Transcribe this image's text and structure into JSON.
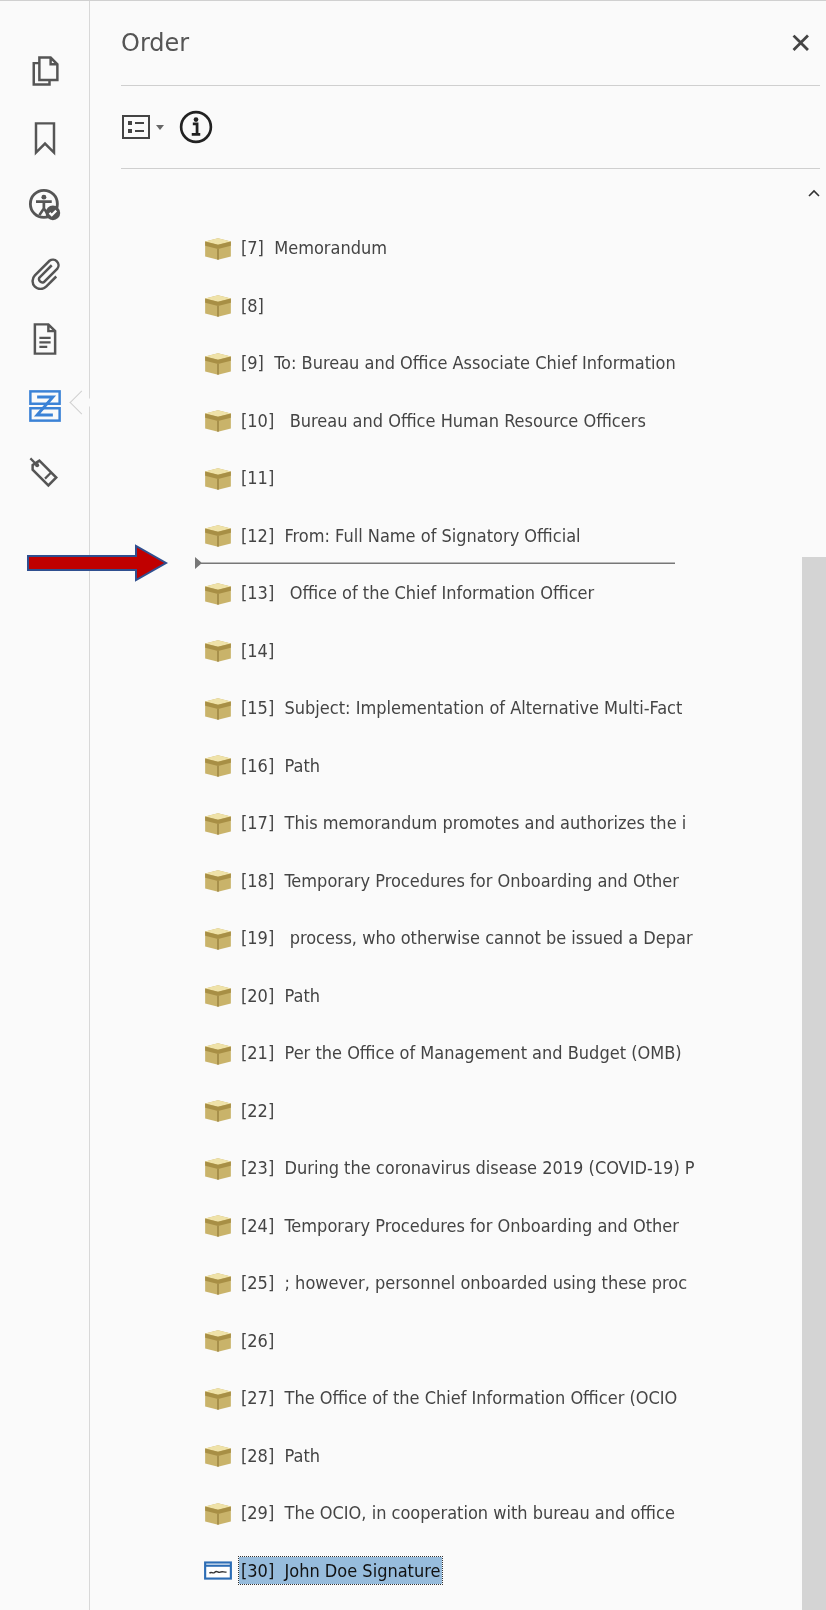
{
  "rail": [
    {
      "kind": "pages",
      "selected": false
    },
    {
      "kind": "bookmarks",
      "selected": false
    },
    {
      "kind": "accessibility",
      "selected": false
    },
    {
      "kind": "attachments",
      "selected": false
    },
    {
      "kind": "content",
      "selected": false
    },
    {
      "kind": "order",
      "selected": true
    },
    {
      "kind": "tags",
      "selected": false
    }
  ],
  "panel": {
    "title": "Order",
    "close": "✕"
  },
  "items": [
    {
      "kind": "container",
      "label": "[7]  Memorandum",
      "selected": false
    },
    {
      "kind": "container",
      "label": "[8]",
      "selected": false
    },
    {
      "kind": "container",
      "label": "[9]  To: Bureau and Office Associate Chief Information",
      "selected": false
    },
    {
      "kind": "container",
      "label": "[10]   Bureau and Office Human Resource Officers",
      "selected": false
    },
    {
      "kind": "container",
      "label": "[11]",
      "selected": false
    },
    {
      "kind": "container",
      "label": "[12]  From: Full Name of Signatory Official",
      "selected": false,
      "insert_after": true
    },
    {
      "kind": "container",
      "label": "[13]   Office of the Chief Information Officer",
      "selected": false
    },
    {
      "kind": "container",
      "label": "[14]",
      "selected": false
    },
    {
      "kind": "container",
      "label": "[15]  Subject: Implementation of Alternative Multi-Fact",
      "selected": false
    },
    {
      "kind": "container",
      "label": "[16]  Path",
      "selected": false
    },
    {
      "kind": "container",
      "label": "[17]  This memorandum promotes and authorizes the i",
      "selected": false
    },
    {
      "kind": "container",
      "label": "[18]  Temporary Procedures for Onboarding and Other",
      "selected": false
    },
    {
      "kind": "container",
      "label": "[19]   process, who otherwise cannot be issued a Depar",
      "selected": false
    },
    {
      "kind": "container",
      "label": "[20]  Path",
      "selected": false
    },
    {
      "kind": "container",
      "label": "[21]  Per the Office of Management and Budget (OMB)",
      "selected": false
    },
    {
      "kind": "container",
      "label": "[22]",
      "selected": false
    },
    {
      "kind": "container",
      "label": "[23]  During the coronavirus disease 2019 (COVID-19) P",
      "selected": false
    },
    {
      "kind": "container",
      "label": "[24]  Temporary Procedures for Onboarding and Other",
      "selected": false
    },
    {
      "kind": "container",
      "label": "[25]  ; however, personnel onboarded using these proc",
      "selected": false
    },
    {
      "kind": "container",
      "label": "[26]",
      "selected": false
    },
    {
      "kind": "container",
      "label": "[27]  The Office of the Chief Information Officer (OCIO",
      "selected": false
    },
    {
      "kind": "container",
      "label": "[28]  Path",
      "selected": false
    },
    {
      "kind": "container",
      "label": "[29]  The OCIO, in cooperation with bureau and office",
      "selected": false
    },
    {
      "kind": "field",
      "label": "[30]  John Doe Signature",
      "selected": true
    }
  ]
}
